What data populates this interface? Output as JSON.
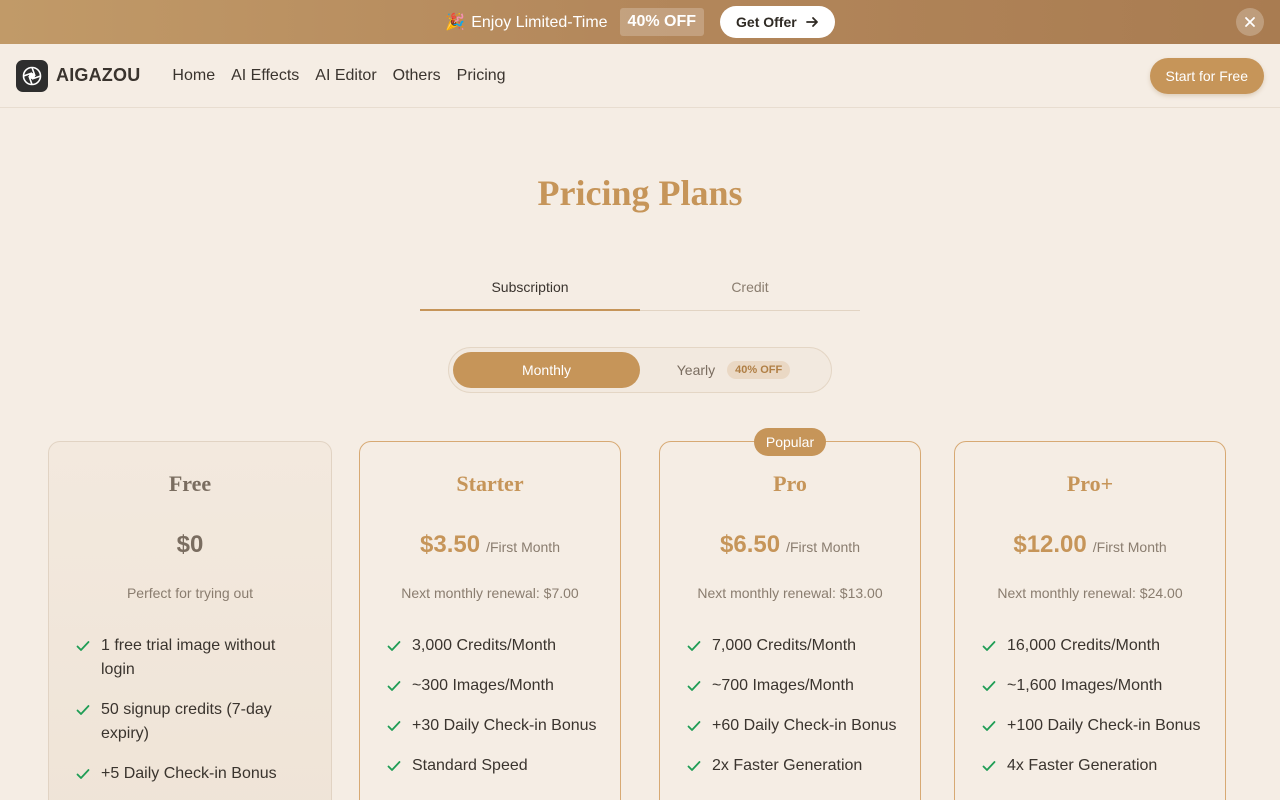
{
  "promo": {
    "emoji": "🎉",
    "text": "Enjoy Limited-Time",
    "badge": "40% OFF",
    "button_label": "Get Offer"
  },
  "nav": {
    "brand": "AIGAZOU",
    "links": [
      "Home",
      "AI Effects",
      "AI Editor",
      "Others",
      "Pricing"
    ],
    "cta_label": "Start for Free"
  },
  "page": {
    "title": "Pricing Plans"
  },
  "tabs": [
    "Subscription",
    "Credit"
  ],
  "toggle": {
    "monthly_label": "Monthly",
    "yearly_label": "Yearly",
    "yearly_badge": "40% OFF"
  },
  "popular_badge": "Popular",
  "plans": [
    {
      "name": "Free",
      "price": "$0",
      "period": "",
      "subtitle": "Perfect for trying out",
      "features": [
        "1 free trial image without login",
        "50 signup credits (7-day expiry)",
        "+5 Daily Check-in Bonus"
      ]
    },
    {
      "name": "Starter",
      "price": "$3.50",
      "period": "/First Month",
      "subtitle": "Next monthly renewal: $7.00",
      "features": [
        "3,000 Credits/Month",
        "~300 Images/Month",
        "+30 Daily Check-in Bonus",
        "Standard Speed"
      ]
    },
    {
      "name": "Pro",
      "price": "$6.50",
      "period": "/First Month",
      "subtitle": "Next monthly renewal: $13.00",
      "features": [
        "7,000 Credits/Month",
        "~700 Images/Month",
        "+60 Daily Check-in Bonus",
        "2x Faster Generation"
      ]
    },
    {
      "name": "Pro+",
      "price": "$12.00",
      "period": "/First Month",
      "subtitle": "Next monthly renewal: $24.00",
      "features": [
        "16,000 Credits/Month",
        "~1,600 Images/Month",
        "+100 Daily Check-in Bonus",
        "4x Faster Generation"
      ]
    }
  ],
  "colors": {
    "accent": "#c69559",
    "background": "#f5ede4",
    "check": "#1f9d55"
  }
}
